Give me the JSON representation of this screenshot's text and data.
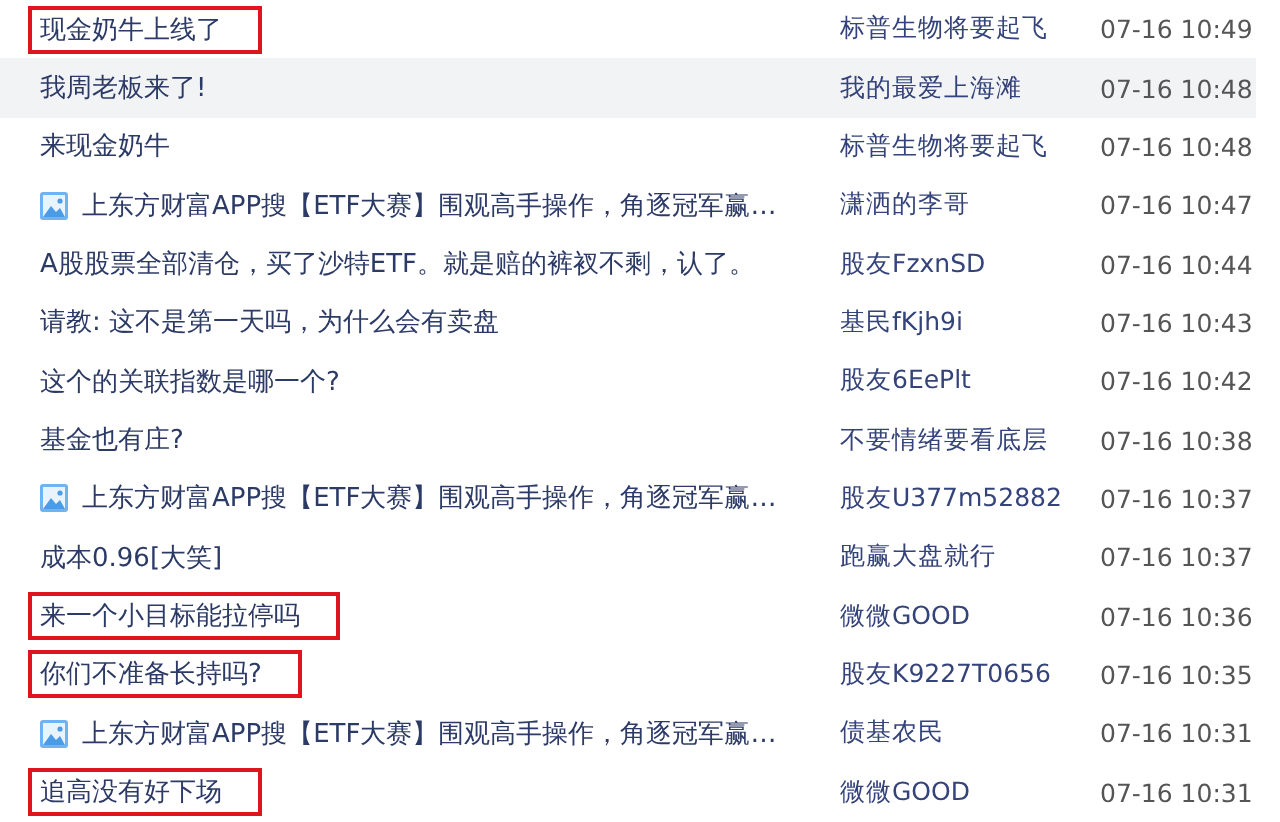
{
  "posts": [
    {
      "kind": "text",
      "title": "现金奶牛上线了",
      "author": "标普生物将要起飞",
      "time": "07-16 10:49",
      "marked": true,
      "hovered": false
    },
    {
      "kind": "text",
      "title": "我周老板来了!",
      "author": "我的最爱上海滩",
      "time": "07-16 10:48",
      "marked": false,
      "hovered": true
    },
    {
      "kind": "text",
      "title": "来现金奶牛",
      "author": "标普生物将要起飞",
      "time": "07-16 10:48",
      "marked": false,
      "hovered": false
    },
    {
      "kind": "image",
      "title": "上东方财富APP搜【ETF大赛】围观高手操作，角逐冠军赢…",
      "author": "潇洒的李哥",
      "time": "07-16 10:47",
      "marked": false,
      "hovered": false
    },
    {
      "kind": "text",
      "title": "A股股票全部清仓，买了沙特ETF。就是赔的裤衩不剩，认了。",
      "author": "股友FzxnSD",
      "time": "07-16 10:44",
      "marked": false,
      "hovered": false
    },
    {
      "kind": "text",
      "title": "请教: 这不是第一天吗，为什么会有卖盘",
      "author": "基民fKjh9i",
      "time": "07-16 10:43",
      "marked": false,
      "hovered": false
    },
    {
      "kind": "text",
      "title": "这个的关联指数是哪一个?",
      "author": "股友6EePlt",
      "time": "07-16 10:42",
      "marked": false,
      "hovered": false
    },
    {
      "kind": "text",
      "title": "基金也有庄?",
      "author": "不要情绪要看底层",
      "time": "07-16 10:38",
      "marked": false,
      "hovered": false
    },
    {
      "kind": "image",
      "title": "上东方财富APP搜【ETF大赛】围观高手操作，角逐冠军赢…",
      "author": "股友U377m52882",
      "time": "07-16 10:37",
      "marked": false,
      "hovered": false
    },
    {
      "kind": "text",
      "title": "成本0.96[大笑]",
      "author": "跑赢大盘就行",
      "time": "07-16 10:37",
      "marked": false,
      "hovered": false
    },
    {
      "kind": "text",
      "title": "来一个小目标能拉停吗",
      "author": "微微GOOD",
      "time": "07-16 10:36",
      "marked": true,
      "hovered": false
    },
    {
      "kind": "text",
      "title": "你们不准备长持吗?",
      "author": "股友K9227T0656",
      "time": "07-16 10:35",
      "marked": true,
      "hovered": false
    },
    {
      "kind": "image",
      "title": "上东方财富APP搜【ETF大赛】围观高手操作，角逐冠军赢…",
      "author": "债基农民",
      "time": "07-16 10:31",
      "marked": false,
      "hovered": false
    },
    {
      "kind": "text",
      "title": "追高没有好下场",
      "author": "微微GOOD",
      "time": "07-16 10:31",
      "marked": true,
      "hovered": false
    }
  ]
}
